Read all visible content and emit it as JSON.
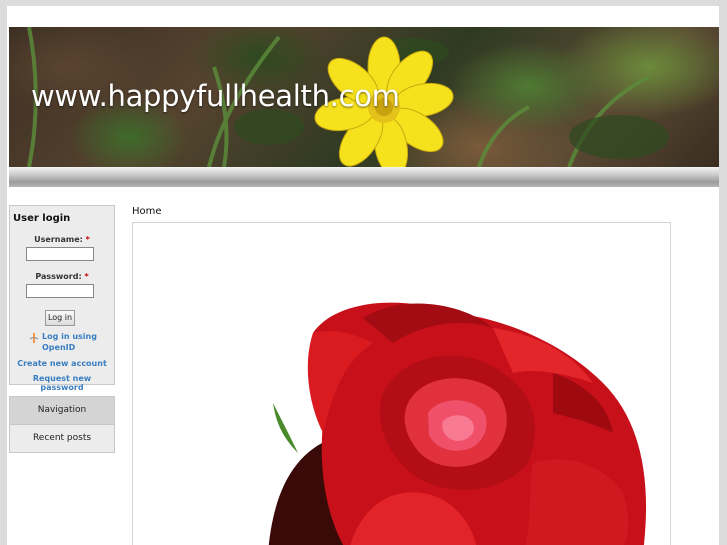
{
  "header": {
    "site_title": "www.happyfullhealth.com"
  },
  "sidebar": {
    "login_block": {
      "title": "User login",
      "username_label": "Username:",
      "password_label": "Password:",
      "required_mark": "*",
      "username_value": "",
      "password_value": "",
      "login_button": "Log in",
      "openid_link": "Log in using OpenID",
      "create_account_link": "Create new account",
      "request_password_link": "Request new password"
    },
    "menu": [
      {
        "label": "Navigation"
      },
      {
        "label": "Recent posts"
      }
    ]
  },
  "main": {
    "breadcrumb": "Home",
    "image": {
      "subject": "red rose"
    }
  },
  "colors": {
    "link": "#3a7ec2",
    "required": "#cc0000",
    "rose": "#c8101a",
    "flower": "#f5e21c"
  },
  "icons": {
    "openid": "openid-icon"
  }
}
